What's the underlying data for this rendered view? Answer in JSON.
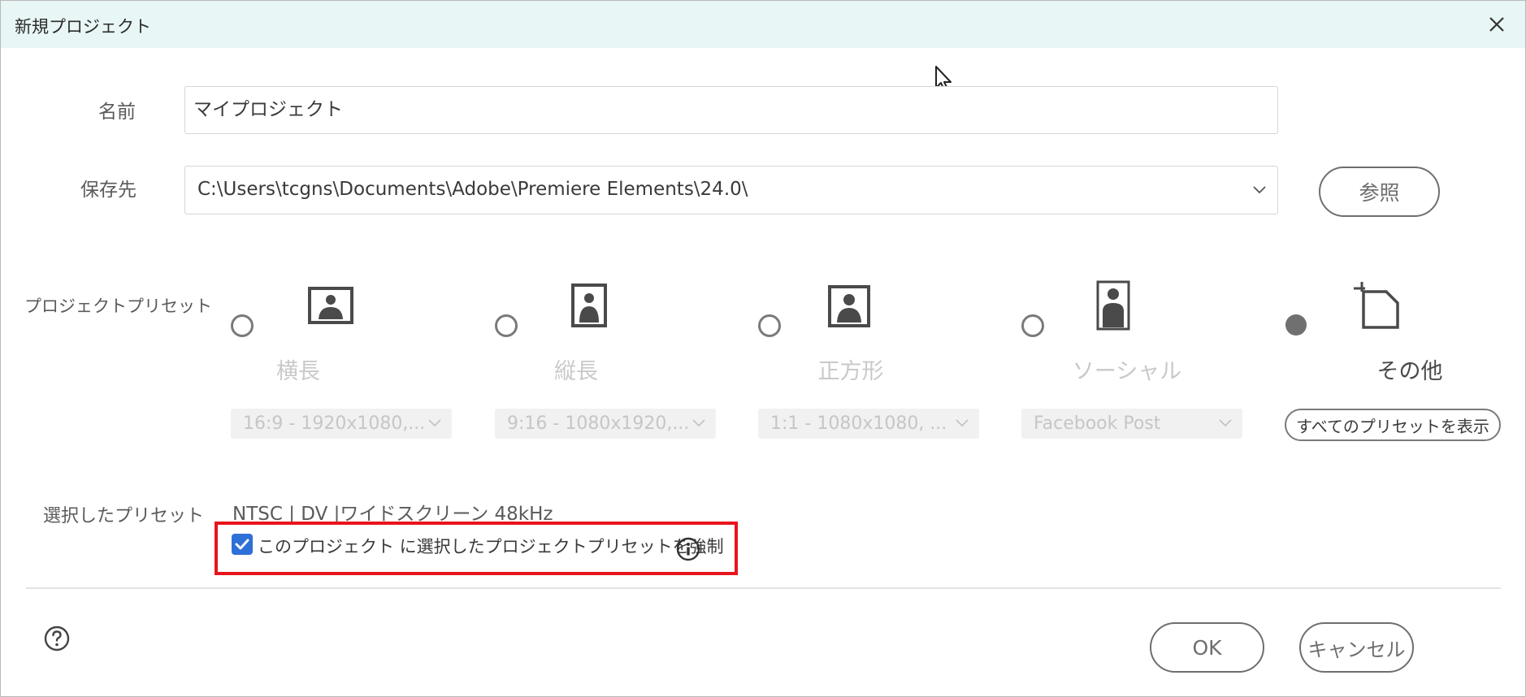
{
  "window": {
    "title": "新規プロジェクト",
    "close_icon": "close-icon"
  },
  "form": {
    "name_label": "名前",
    "name_value": "マイプロジェクト",
    "location_label": "保存先",
    "location_value": "C:\\Users\\tcgns\\Documents\\Adobe\\Premiere Elements\\24.0\\",
    "browse_label": "参照"
  },
  "presets": {
    "section_label": "プロジェクトプリセット",
    "options": [
      {
        "label": "横長",
        "dropdown": "16:9 - 1920x1080,...",
        "icon": "landscape-photo-icon",
        "selected": false
      },
      {
        "label": "縦長",
        "dropdown": "9:16 - 1080x1920,...",
        "icon": "portrait-photo-icon",
        "selected": false
      },
      {
        "label": "正方形",
        "dropdown": "1:1 - 1080x1080, ...",
        "icon": "square-photo-icon",
        "selected": false
      },
      {
        "label": "ソーシャル",
        "dropdown": "Facebook Post",
        "icon": "social-phone-icon",
        "selected": false
      },
      {
        "label": "その他",
        "dropdown": "",
        "icon": "crop-icon",
        "selected": true
      }
    ],
    "show_all_label": "すべてのプリセットを表示"
  },
  "selected_preset": {
    "label": "選択したプリセット",
    "value": "NTSC | DV |ワイドスクリーン  48kHz",
    "force_checkbox_label": "このプロジェクト に選択したプロジェクトプリセットを強制",
    "force_checked": true
  },
  "footer": {
    "ok_label": "OK",
    "cancel_label": "キャンセル"
  },
  "colors": {
    "titlebar_bg": "#e8f6f5",
    "checkbox_accent": "#2f6fd8",
    "highlight": "#e8141b"
  }
}
